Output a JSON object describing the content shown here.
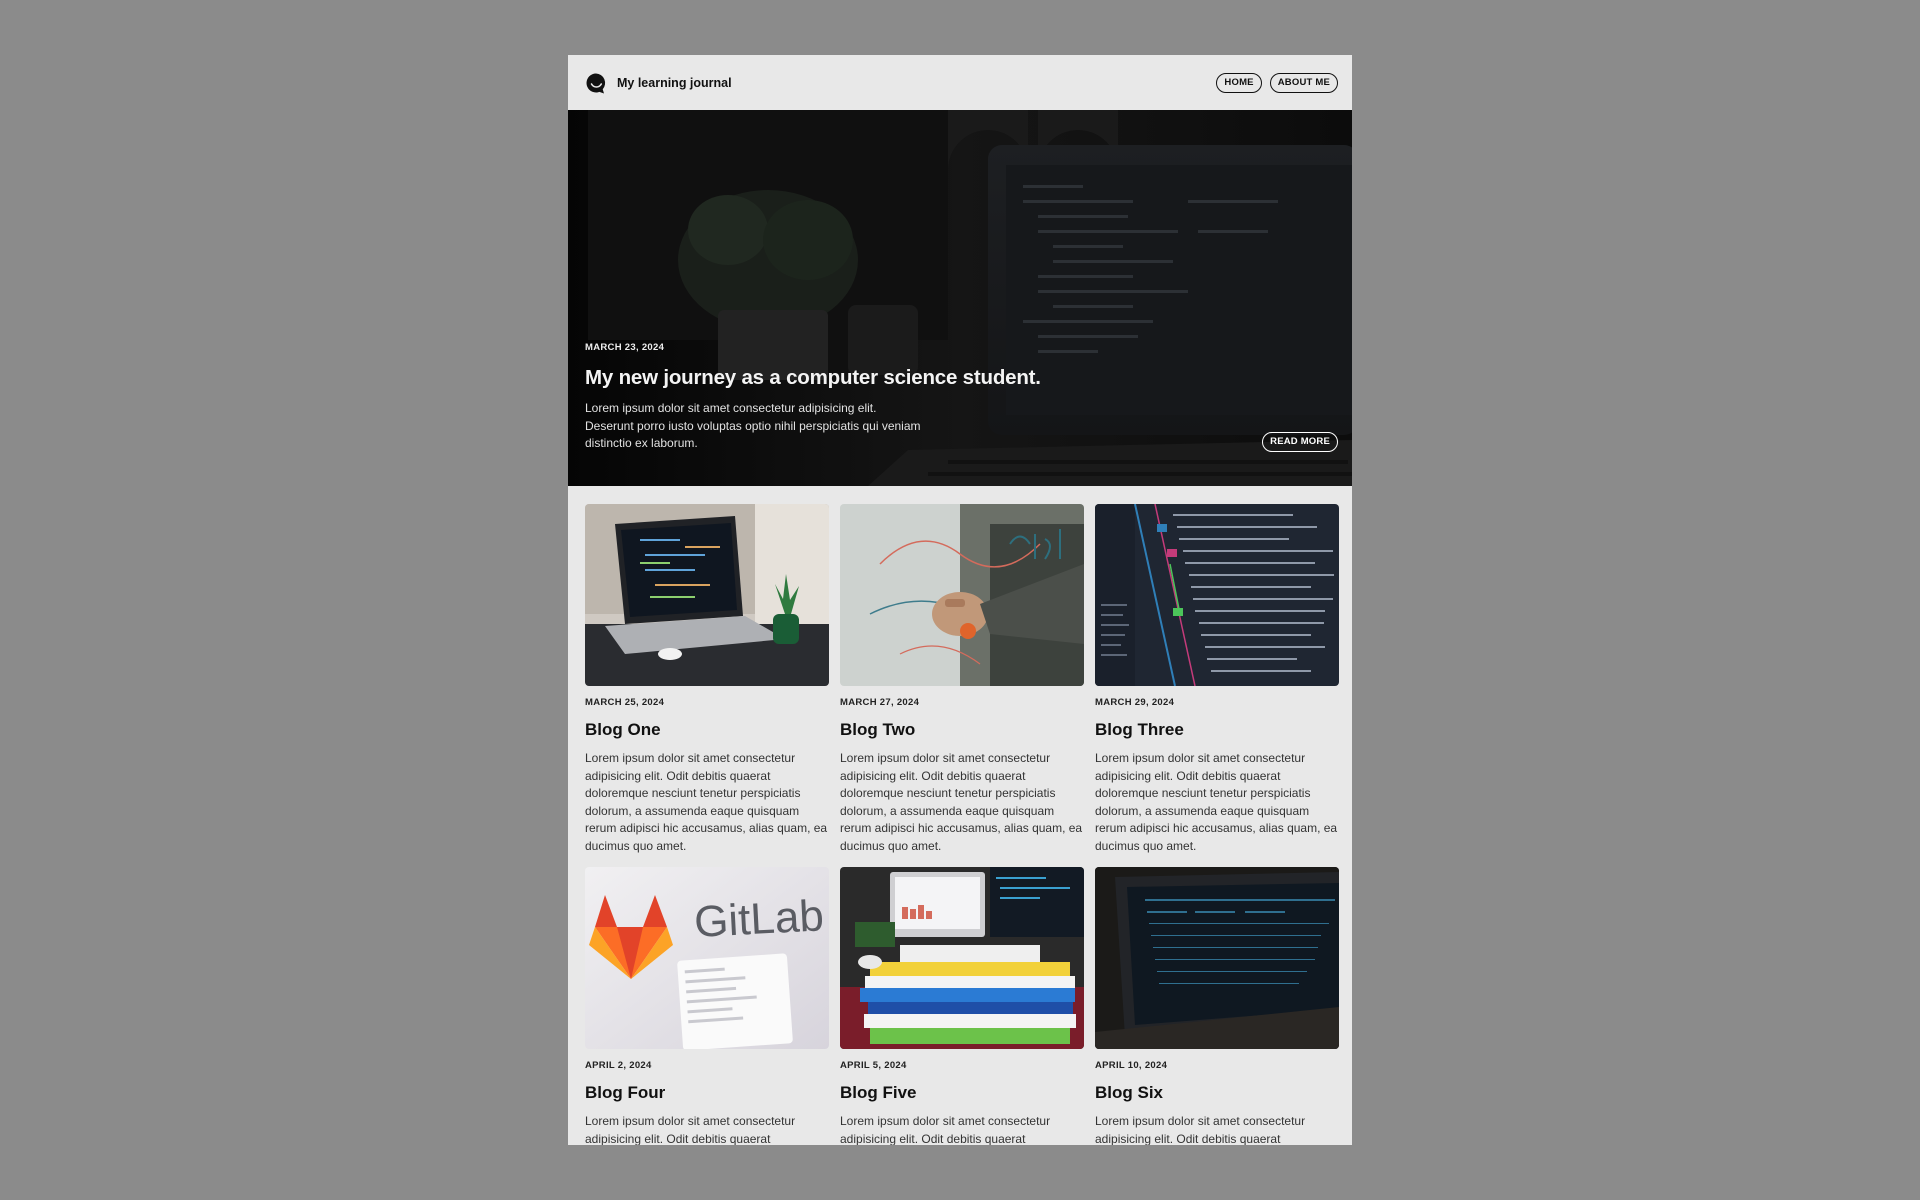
{
  "header": {
    "site_title": "My learning journal",
    "logo_icon": "chat-bubble-smile-icon",
    "nav": [
      {
        "label": "HOME"
      },
      {
        "label": "ABOUT ME"
      }
    ]
  },
  "hero": {
    "date": "MARCH 23, 2024",
    "title": "My new journey as a computer science student.",
    "text": "Lorem ipsum dolor sit amet consectetur adipisicing elit. Deserunt porro iusto voluptas optio nihil perspiciatis qui veniam distinctio ex laborum.",
    "button_label": "READ MORE"
  },
  "posts": [
    {
      "date": "MARCH 25, 2024",
      "title": "Blog One",
      "text": "Lorem ipsum dolor sit amet consectetur adipisicing elit. Odit debitis quaerat doloremque nesciunt tenetur perspiciatis dolorum, a assumenda eaque quisquam rerum adipisci hic accusamus, alias quam, ea ducimus quo amet."
    },
    {
      "date": "MARCH 27, 2024",
      "title": "Blog Two",
      "text": "Lorem ipsum dolor sit amet consectetur adipisicing elit. Odit debitis quaerat doloremque nesciunt tenetur perspiciatis dolorum, a assumenda eaque quisquam rerum adipisci hic accusamus, alias quam, ea ducimus quo amet."
    },
    {
      "date": "MARCH 29, 2024",
      "title": "Blog Three",
      "text": "Lorem ipsum dolor sit amet consectetur adipisicing elit. Odit debitis quaerat doloremque nesciunt tenetur perspiciatis dolorum, a assumenda eaque quisquam rerum adipisci hic accusamus, alias quam, ea ducimus quo amet."
    },
    {
      "date": "APRIL 2, 2024",
      "title": "Blog Four",
      "text": "Lorem ipsum dolor sit amet consectetur adipisicing elit. Odit debitis quaerat",
      "image_text": "GitLab"
    },
    {
      "date": "APRIL 5, 2024",
      "title": "Blog Five",
      "text": "Lorem ipsum dolor sit amet consectetur adipisicing elit. Odit debitis quaerat"
    },
    {
      "date": "APRIL 10, 2024",
      "title": "Blog Six",
      "text": "Lorem ipsum dolor sit amet consectetur adipisicing elit. Odit debitis quaerat"
    }
  ],
  "colors": {
    "page_background": "#8b8b8b",
    "content_background": "#e8e8e8",
    "hero_background": "#0b0b0b",
    "text": "#111111"
  }
}
